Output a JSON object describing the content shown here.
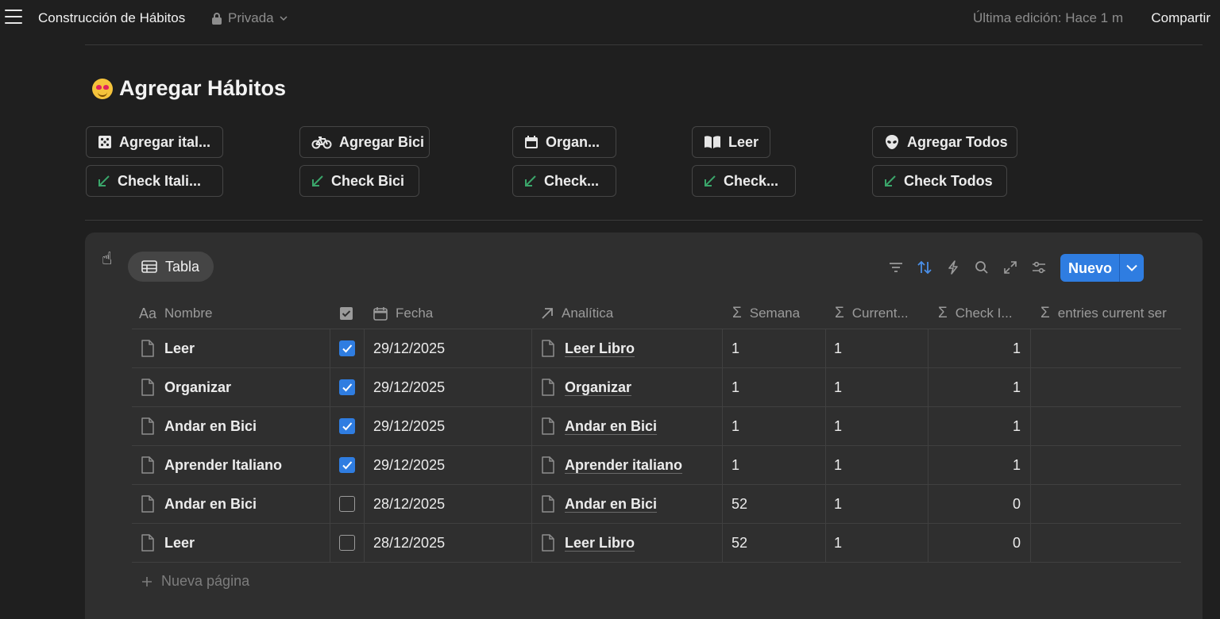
{
  "topbar": {
    "page_name": "Construcción de Hábitos",
    "privacy": "Privada",
    "last_edit": "Última edición: Hace 1 m",
    "share": "Compartir"
  },
  "section": {
    "title": "Agregar Hábitos"
  },
  "quick_buttons": {
    "add_italiano": "Agregar ital...",
    "add_bici": "Agregar Bici",
    "organizar": "Organ...",
    "leer": "Leer",
    "add_todos": "Agregar Todos",
    "check_italiano": "Check Itali...",
    "check_bici": "Check Bici",
    "check_organizar": "Check...",
    "check_leer": "Check...",
    "check_todos": "Check Todos"
  },
  "database": {
    "view_tab": "Tabla",
    "new_button": "Nuevo",
    "columns": {
      "nombre": "Nombre",
      "fecha": "Fecha",
      "analitica": "Analítica",
      "semana": "Semana",
      "current": "Current...",
      "check": "Check I...",
      "entries": "entries current ser"
    },
    "rows": [
      {
        "nombre": "Leer",
        "checked": true,
        "fecha": "29/12/2025",
        "analitica": "Leer Libro",
        "semana": "1",
        "current": "1",
        "check": "1"
      },
      {
        "nombre": "Organizar",
        "checked": true,
        "fecha": "29/12/2025",
        "analitica": "Organizar",
        "semana": "1",
        "current": "1",
        "check": "1"
      },
      {
        "nombre": "Andar en Bici",
        "checked": true,
        "fecha": "29/12/2025",
        "analitica": "Andar en Bici",
        "semana": "1",
        "current": "1",
        "check": "1"
      },
      {
        "nombre": "Aprender Italiano",
        "checked": true,
        "fecha": "29/12/2025",
        "analitica": "Aprender italiano",
        "semana": "1",
        "current": "1",
        "check": "1"
      },
      {
        "nombre": "Andar en Bici",
        "checked": false,
        "fecha": "28/12/2025",
        "analitica": "Andar en Bici",
        "semana": "52",
        "current": "1",
        "check": "0"
      },
      {
        "nombre": "Leer",
        "checked": false,
        "fecha": "28/12/2025",
        "analitica": "Leer Libro",
        "semana": "52",
        "current": "1",
        "check": "0"
      }
    ],
    "new_page": "Nueva página"
  },
  "colors": {
    "accent": "#2f7de1",
    "check_arrow": "#3aa56a",
    "background": "#1f1f1f",
    "panel": "#2f2f2f"
  }
}
